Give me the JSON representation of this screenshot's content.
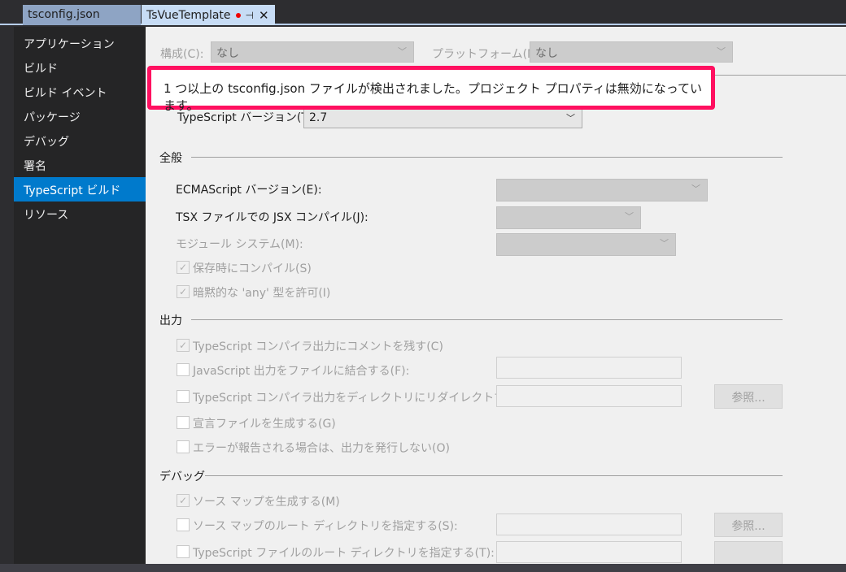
{
  "tabs": [
    {
      "label": "tsconfig.json"
    },
    {
      "label": "TsVueTemplate",
      "modified": true
    }
  ],
  "sidebar": {
    "items": [
      {
        "label": "アプリケーション"
      },
      {
        "label": "ビルド"
      },
      {
        "label": "ビルド イベント"
      },
      {
        "label": "パッケージ"
      },
      {
        "label": "デバッグ"
      },
      {
        "label": "署名"
      },
      {
        "label": "TypeScript ビルド",
        "selected": true
      },
      {
        "label": "リソース"
      }
    ]
  },
  "header": {
    "config_label": "構成(C):",
    "config_value": "なし",
    "platform_label": "プラットフォーム(M):",
    "platform_value": "なし"
  },
  "alert": {
    "text": "1 つ以上の tsconfig.json ファイルが検出されました。プロジェクト プロパティは無効になっています。"
  },
  "ts_version": {
    "label": "TypeScript バージョン(T):",
    "value": "2.7"
  },
  "general": {
    "title": "全般",
    "ecma_label": "ECMAScript バージョン(E):",
    "jsx_label": "TSX ファイルでの JSX コンパイル(J):",
    "module_label": "モジュール システム(M):",
    "compile_on_save": "保存時にコンパイル(S)",
    "implicit_any": "暗黙的な 'any' 型を許可(I)"
  },
  "output": {
    "title": "出力",
    "keep_comments": "TypeScript コンパイラ出力にコメントを残す(C)",
    "combine_js": "JavaScript 出力をファイルに結合する(F):",
    "redirect": "TypeScript コンパイラ出力をディレクトリにリダイレクトする(D):",
    "declarations": "宣言ファイルを生成する(G)",
    "no_emit_on_error": "エラーが報告される場合は、出力を発行しない(O)",
    "browse_label": "参照..."
  },
  "debug": {
    "title": "デバッグ",
    "source_maps": "ソース マップを生成する(M)",
    "map_root": "ソース マップのルート ディレクトリを指定する(S):",
    "source_root": "TypeScript ファイルのルート ディレクトリを指定する(T):",
    "browse_label": "参照..."
  },
  "colors": {
    "accent": "#007acc",
    "alert_border": "#ff1060"
  }
}
